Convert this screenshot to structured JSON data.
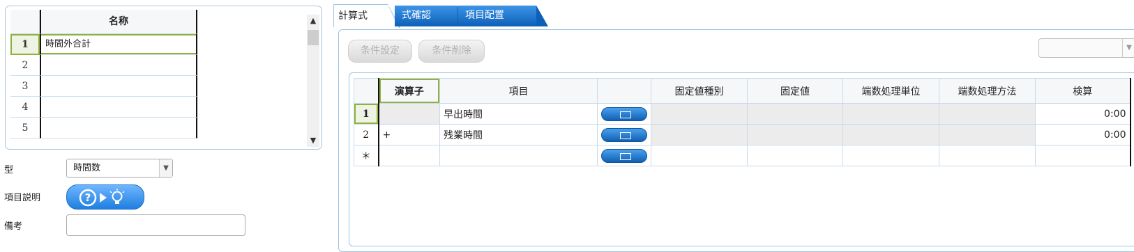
{
  "name_grid": {
    "header": "名称",
    "rows": [
      {
        "num": "1",
        "name": "時間外合計"
      },
      {
        "num": "2",
        "name": ""
      },
      {
        "num": "3",
        "name": ""
      },
      {
        "num": "4",
        "name": ""
      },
      {
        "num": "5",
        "name": ""
      }
    ]
  },
  "form": {
    "type_label": "型",
    "type_value": "時間数",
    "desc_label": "項目説明",
    "memo_label": "備考",
    "memo_value": ""
  },
  "tabs": [
    {
      "label": "計算式",
      "active": true
    },
    {
      "label": "式確認",
      "active": false
    },
    {
      "label": "項目配置",
      "active": false
    }
  ],
  "toolbar": {
    "cond_set_label": "条件設定",
    "cond_delete_label": "条件削除",
    "side_select_value": ""
  },
  "calc_grid": {
    "headers": {
      "operator": "演算子",
      "item": "項目",
      "pick": "",
      "fixed_type": "固定値種別",
      "fixed_value": "固定値",
      "round_unit": "端数処理単位",
      "round_method": "端数処理方法",
      "calc": "検算"
    },
    "rows": [
      {
        "num": "1",
        "operator": "",
        "item": "早出時間",
        "fixed_type": "",
        "fixed_value": "",
        "round_unit": "",
        "round_method": "",
        "calc": "0:00"
      },
      {
        "num": "2",
        "operator": "+",
        "item": "残業時間",
        "fixed_type": "",
        "fixed_value": "",
        "round_unit": "",
        "round_method": "",
        "calc": "0:00"
      },
      {
        "num": "＊",
        "operator": "",
        "item": "",
        "fixed_type": "",
        "fixed_value": "",
        "round_unit": "",
        "round_method": "",
        "calc": ""
      }
    ]
  },
  "colors": {
    "tab_blue": "#1a6fce",
    "selection_green": "#8fb23f",
    "border_blue": "#9cc3e4"
  },
  "icons": [
    "chevron-up-icon",
    "chevron-down-icon",
    "help-icon",
    "play-icon",
    "lightbulb-icon",
    "select-window-icon"
  ]
}
